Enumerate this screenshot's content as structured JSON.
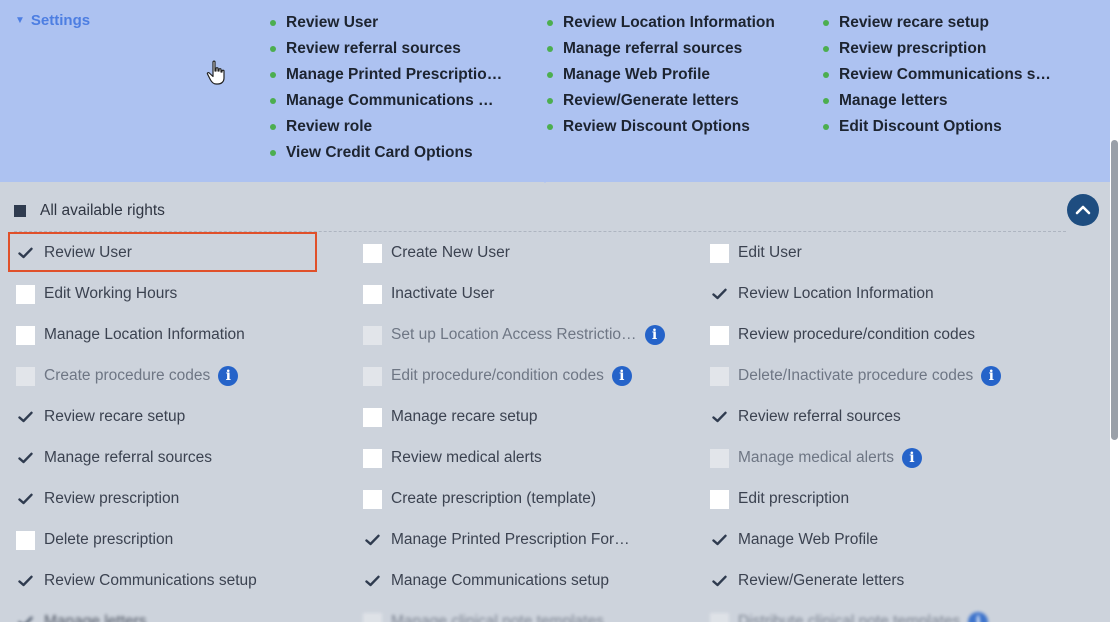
{
  "settings": {
    "label": "Settings"
  },
  "summary": {
    "col1": [
      "Review User",
      "Review referral sources",
      "Manage Printed Prescriptio…",
      "Manage Communications …",
      "Review role",
      "View Credit Card Options"
    ],
    "col2": [
      "Review Location Information",
      "Manage referral sources",
      "Manage Web Profile",
      "Review/Generate letters",
      "Review Discount Options"
    ],
    "col3": [
      "Review recare setup",
      "Review prescription",
      "Review Communications s…",
      "Manage letters",
      "Edit Discount Options"
    ]
  },
  "all_rights": {
    "label": "All available rights"
  },
  "rights": {
    "r0": [
      "Review User",
      "Create New User",
      "Edit User"
    ],
    "r1": [
      "Edit Working Hours",
      "Inactivate User",
      "Review Location Information"
    ],
    "r2": [
      "Manage Location Information",
      "Set up Location Access Restrictio…",
      "Review procedure/condition codes"
    ],
    "r3": [
      "Create procedure codes",
      "Edit procedure/condition codes",
      "Delete/Inactivate procedure codes"
    ],
    "r4": [
      "Review recare setup",
      "Manage recare setup",
      "Review referral sources"
    ],
    "r5": [
      "Manage referral sources",
      "Review medical alerts",
      "Manage medical alerts"
    ],
    "r6": [
      "Review prescription",
      "Create prescription (template)",
      "Edit prescription"
    ],
    "r7": [
      "Delete prescription",
      "Manage Printed Prescription For…",
      "Manage Web Profile"
    ],
    "r8": [
      "Review Communications setup",
      "Manage Communications setup",
      "Review/Generate letters"
    ],
    "r9": [
      "Manage letters",
      "Manage clinical note templates",
      "Distribute clinical note templates"
    ]
  },
  "colors": {
    "summary_bg": "#adc2f1",
    "panel_bg": "#cdd3dc",
    "accent_blue": "#4d7ee2",
    "info_blue": "#2563c9",
    "bullet_green": "#4cae4f",
    "highlight_red": "#e0502a"
  },
  "icons": {
    "toggle": "caret-down-icon",
    "cursor": "hand-pointer-icon",
    "collapse": "chevron-up-icon",
    "info": "info-icon",
    "check": "check-icon"
  }
}
